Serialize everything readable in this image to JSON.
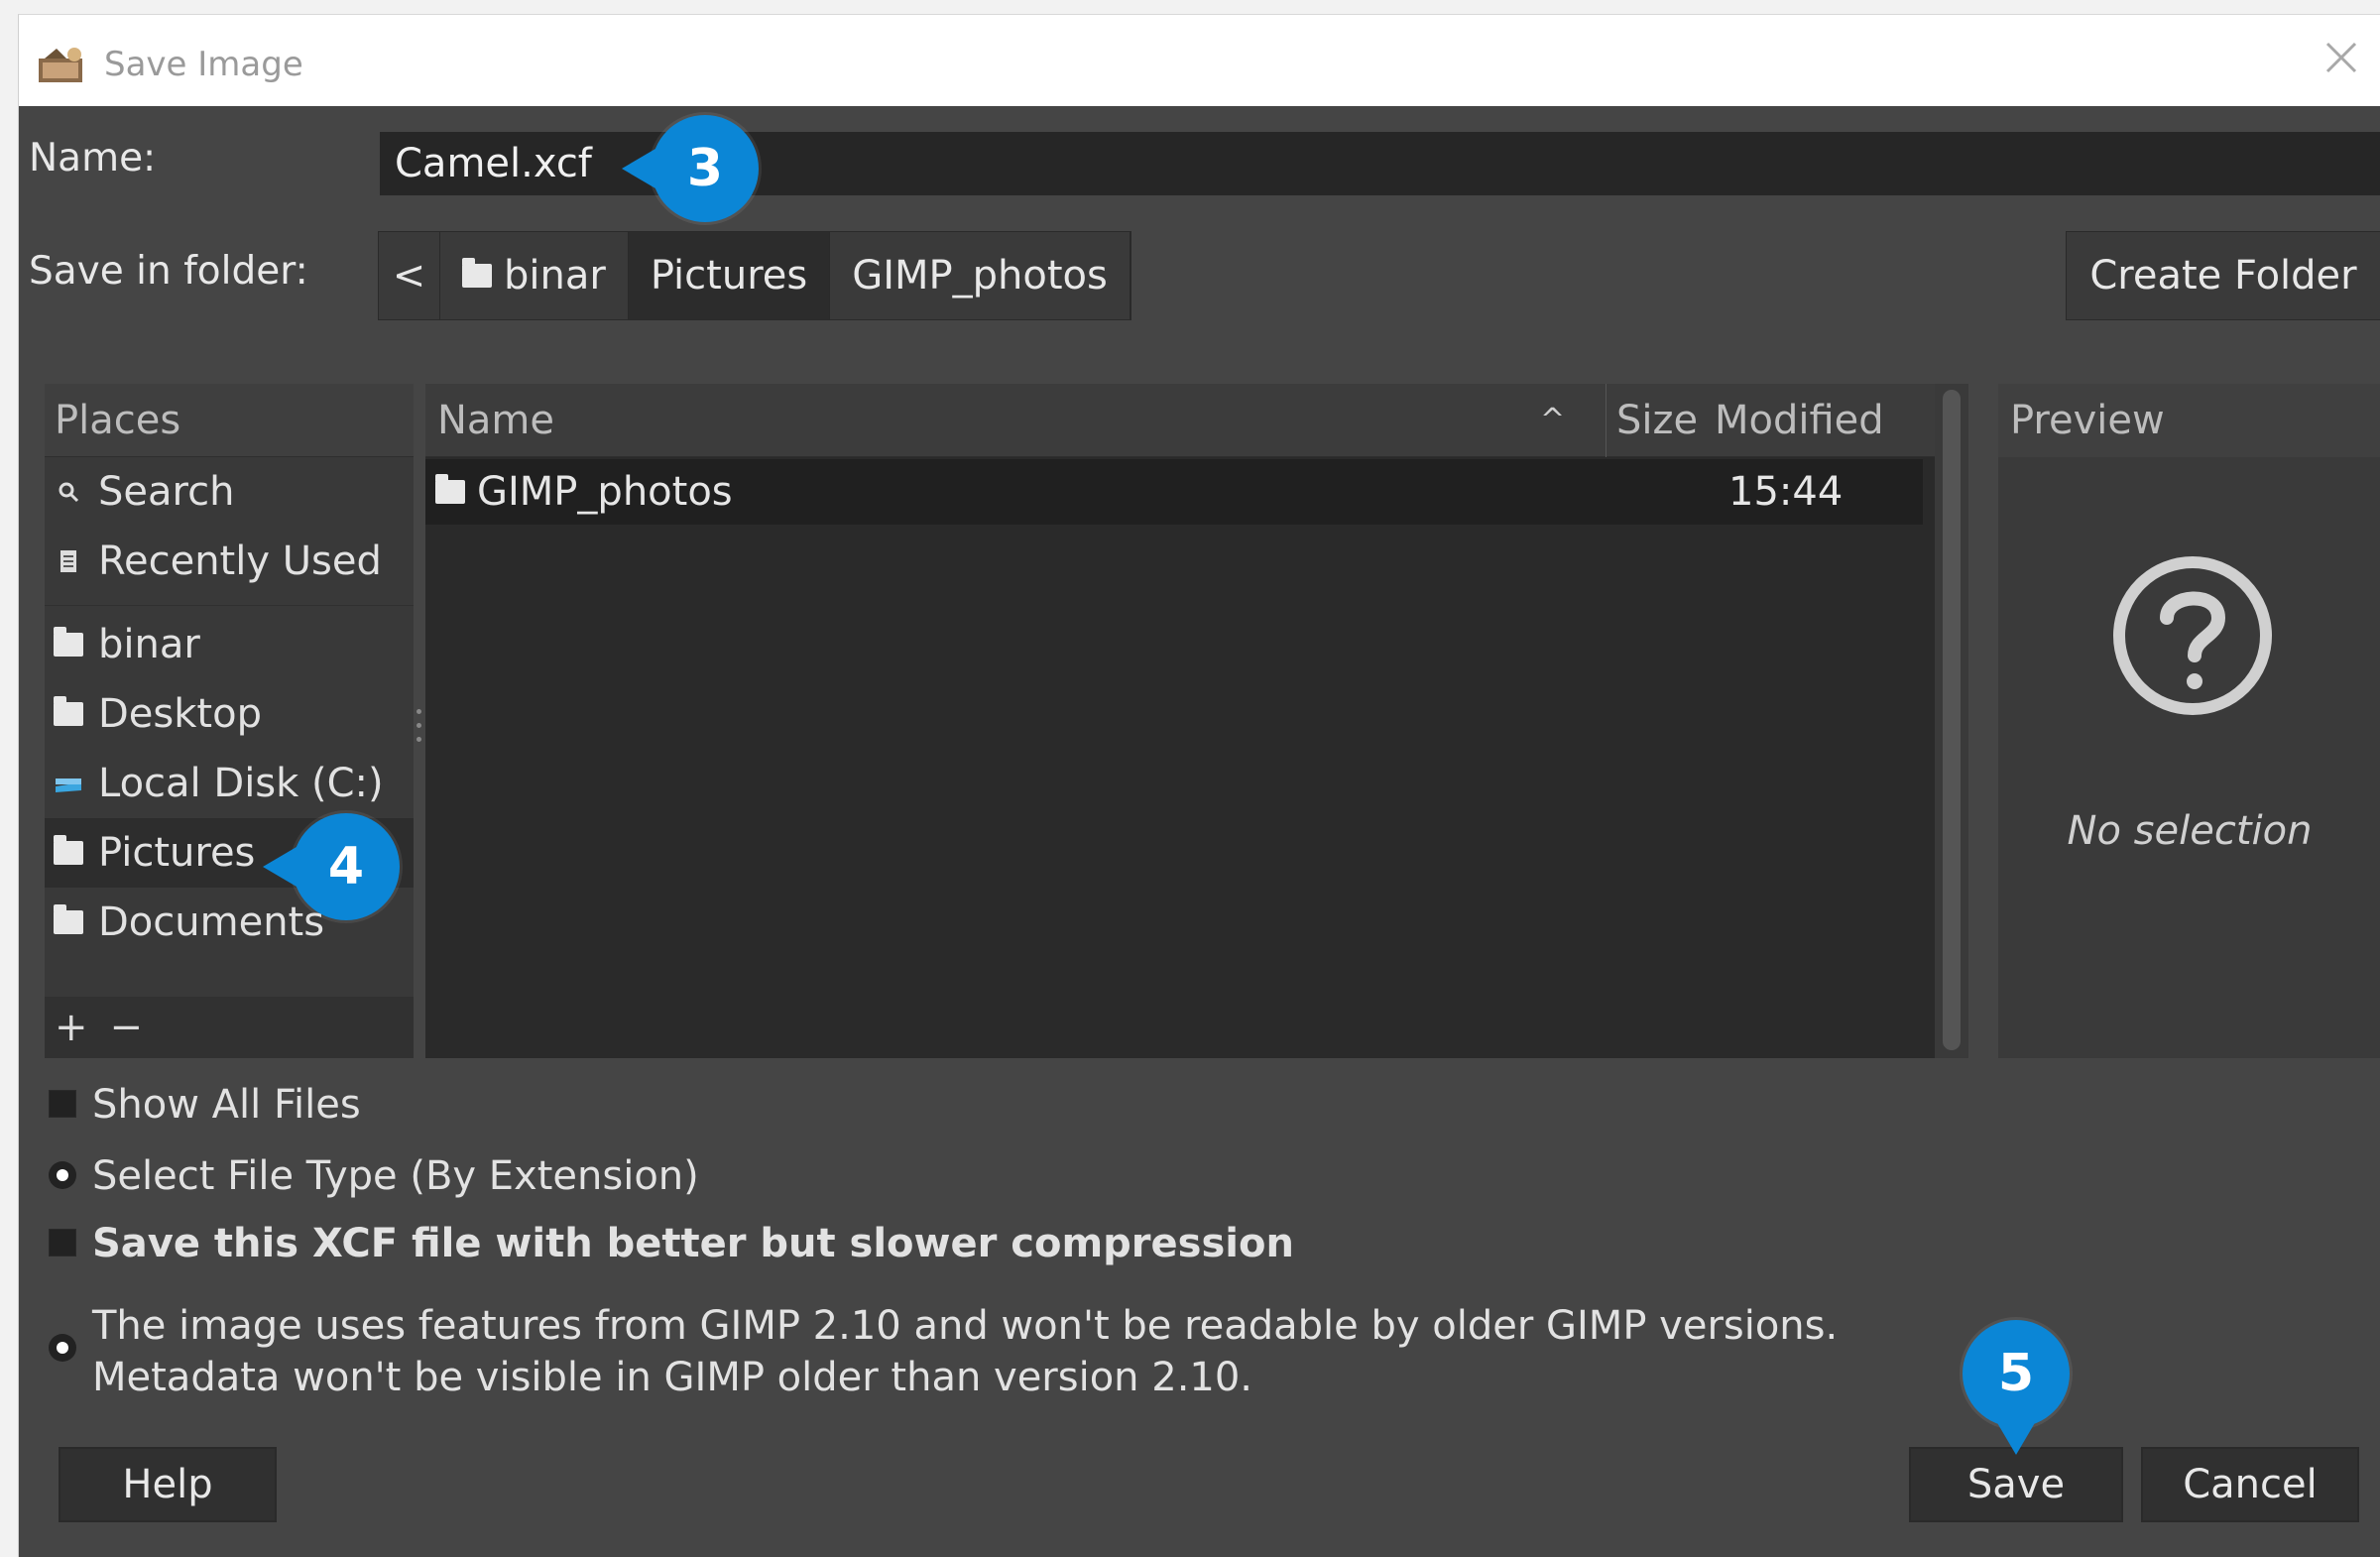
{
  "window": {
    "title": "Save Image"
  },
  "name_field": {
    "label": "Name:",
    "value": "Camel.xcf"
  },
  "folder": {
    "label": "Save in folder:",
    "back_symbol": "<",
    "path": [
      "binar",
      "Pictures",
      "GIMP_photos"
    ],
    "active_segment": "Pictures",
    "create_folder_label": "Create Folder"
  },
  "places": {
    "header": "Places",
    "items": [
      {
        "label": "Search",
        "icon": "search-icon"
      },
      {
        "label": "Recently Used",
        "icon": "recent-icon"
      },
      {
        "label": "binar",
        "icon": "folder-icon"
      },
      {
        "label": "Desktop",
        "icon": "folder-icon"
      },
      {
        "label": "Local Disk (C:)",
        "icon": "drive-icon"
      },
      {
        "label": "Pictures",
        "icon": "folder-icon",
        "selected": true
      },
      {
        "label": "Documents",
        "icon": "folder-icon"
      }
    ],
    "add_symbol": "+",
    "remove_symbol": "−"
  },
  "files": {
    "columns": {
      "name": "Name",
      "sort_symbol": "^",
      "size": "Size",
      "modified": "Modified"
    },
    "rows": [
      {
        "name": "GIMP_photos",
        "size": "",
        "modified": "15:44",
        "icon": "folder-icon"
      }
    ]
  },
  "preview": {
    "header": "Preview",
    "empty_text": "No selection",
    "icon": "question-icon"
  },
  "options": {
    "show_all_files": "Show All Files",
    "select_file_type": "Select File Type (By Extension)",
    "compression": "Save this XCF file with better but slower compression",
    "compat_line1": "The image uses features from GIMP 2.10 and won't be readable by older GIMP versions.",
    "compat_line2": "Metadata won't be visible in GIMP older than version 2.10."
  },
  "buttons": {
    "help": "Help",
    "save": "Save",
    "cancel": "Cancel"
  },
  "callouts": {
    "step3": "3",
    "step4": "4",
    "step5": "5"
  },
  "colors": {
    "callout": "#0b86d6",
    "dialog_bg": "#454545",
    "list_bg": "#2a2a2a"
  }
}
